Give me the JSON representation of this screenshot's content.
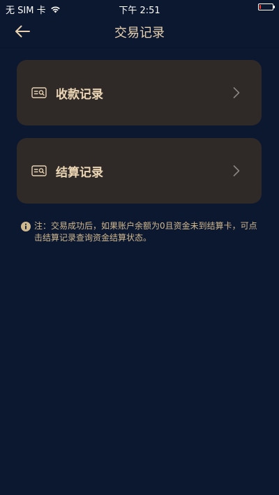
{
  "status_bar": {
    "carrier": "无 SIM 卡",
    "time": "下午 2:51",
    "battery_level": 0.1
  },
  "header": {
    "title": "交易记录",
    "back_icon": "arrow-left-icon"
  },
  "menu": {
    "items": [
      {
        "label": "收款记录",
        "icon": "card-search-icon"
      },
      {
        "label": "结算记录",
        "icon": "card-search-icon"
      }
    ]
  },
  "note": {
    "icon": "info-icon",
    "text": "注：交易成功后，如果账户余额为0且资金未到结算卡，可点击结算记录查询资金结算状态。"
  },
  "colors": {
    "background": "#0c1730",
    "card": "#2f2a28",
    "accent": "#e9d2b0",
    "battery_low": "#ff3b30"
  }
}
